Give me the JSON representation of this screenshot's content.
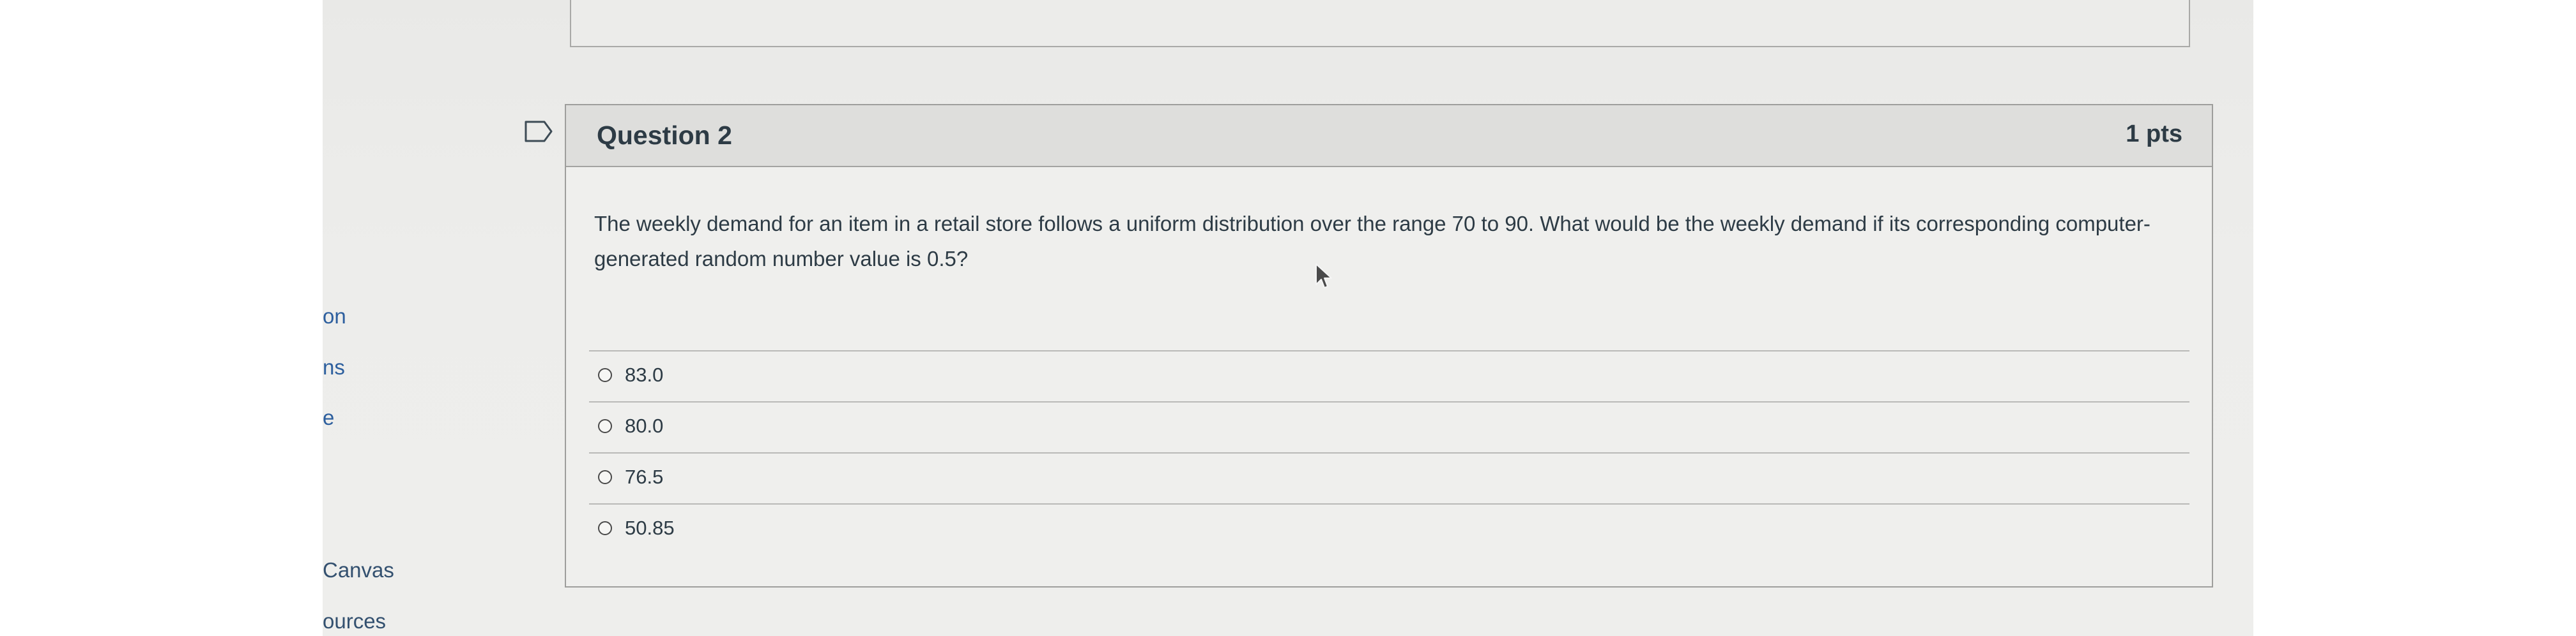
{
  "sidebar": {
    "items": [
      {
        "label": "on"
      },
      {
        "label": "ns"
      },
      {
        "label": "e"
      },
      {
        "label": "Canvas"
      },
      {
        "label": "ources"
      }
    ]
  },
  "question": {
    "title": "Question 2",
    "points": "1 pts",
    "text": "The weekly demand for an item in a retail store follows a uniform distribution over the range 70 to 90. What would be the weekly demand if its corresponding computer-generated random number value is 0.5?",
    "answers": [
      {
        "label": "83.0"
      },
      {
        "label": "80.0"
      },
      {
        "label": "76.5"
      },
      {
        "label": "50.85"
      }
    ]
  },
  "icons": {
    "flag": "flag-outline-icon",
    "radio": "radio-unchecked-icon",
    "cursor": "mouse-pointer-icon"
  }
}
